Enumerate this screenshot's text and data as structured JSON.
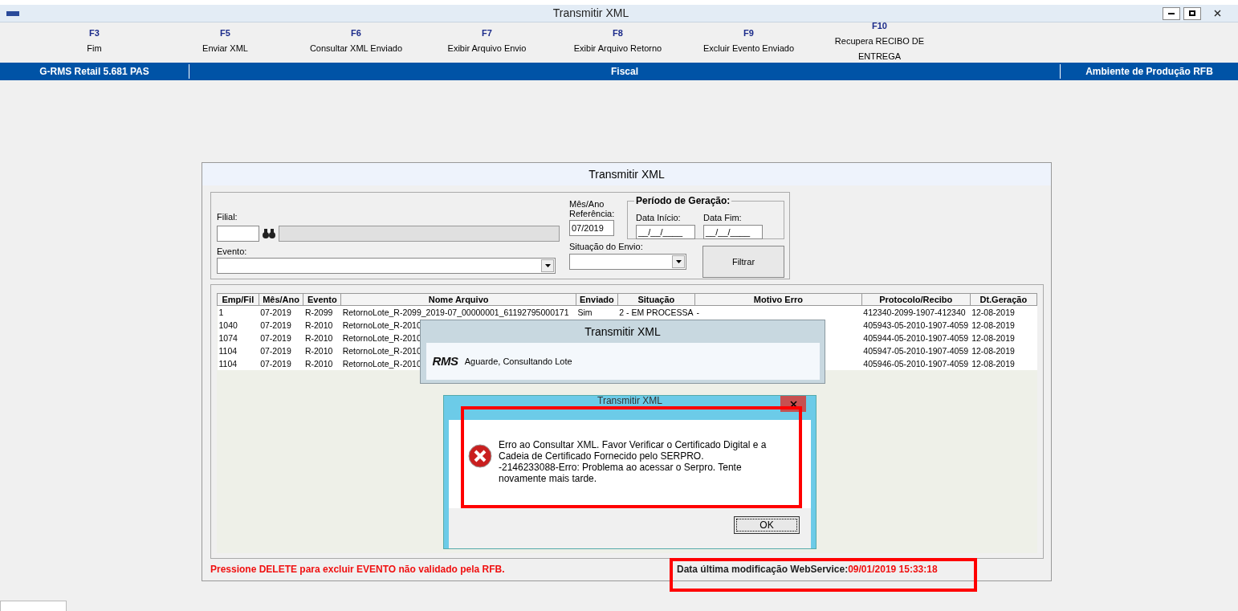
{
  "window": {
    "title": "Transmitir XML"
  },
  "toolbar": [
    {
      "key": "F3",
      "label": "Fim"
    },
    {
      "key": "F5",
      "label": "Enviar XML"
    },
    {
      "key": "F6",
      "label": "Consultar XML Enviado"
    },
    {
      "key": "F7",
      "label": "Exibir Arquivo Envio"
    },
    {
      "key": "F8",
      "label": "Exibir Arquivo Retorno"
    },
    {
      "key": "F9",
      "label": "Excluir Evento Enviado"
    },
    {
      "key": "F10",
      "label": "Recupera RECIBO DE ENTREGA"
    }
  ],
  "info_bar": {
    "version": "G-RMS Retail 5.681 PAS",
    "module": "Fiscal",
    "environment": "Ambiente de Produção RFB"
  },
  "panel": {
    "title": "Transmitir XML",
    "filters": {
      "filial_label": "Filial:",
      "evento_label": "Evento:",
      "mes_ano_label": "Mês/Ano Referência:",
      "mes_ano_value": "07/2019",
      "situacao_label": "Situação do Envio:",
      "periodo_title": "Período de Geração:",
      "data_inicio_label": "Data Início:",
      "data_inicio_value": "__/__/____",
      "data_fim_label": "Data Fim:",
      "data_fim_value": "__/__/____",
      "filter_button": "Filtrar"
    },
    "table": {
      "columns": [
        "Emp/Fil",
        "Mês/Ano",
        "Evento",
        "Nome Arquivo",
        "Enviado",
        "Situação",
        "Motivo Erro",
        "Protocolo/Recibo",
        "Dt.Geração"
      ],
      "rows": [
        [
          "1",
          "07-2019",
          "R-2099",
          "RetornoLote_R-2099_2019-07_00000001_61192795000171",
          "Sim",
          "2 - EM PROCESSA",
          "-",
          "412340-2099-1907-412340",
          "12-08-2019"
        ],
        [
          "1040",
          "07-2019",
          "R-2010",
          "RetornoLote_R-2010",
          "",
          "",
          "",
          "405943-05-2010-1907-4059",
          "12-08-2019"
        ],
        [
          "1074",
          "07-2019",
          "R-2010",
          "RetornoLote_R-2010",
          "",
          "",
          "",
          "405944-05-2010-1907-4059",
          "12-08-2019"
        ],
        [
          "1104",
          "07-2019",
          "R-2010",
          "RetornoLote_R-2010",
          "",
          "",
          "",
          "405947-05-2010-1907-4059",
          "12-08-2019"
        ],
        [
          "1104",
          "07-2019",
          "R-2010",
          "RetornoLote_R-2010",
          "",
          "",
          "",
          "405946-05-2010-1907-4059",
          "12-08-2019"
        ]
      ]
    },
    "hint": "Pressione DELETE para excluir EVENTO não validado pela RFB.",
    "webservice_label": "Data última modificação WebService:",
    "webservice_value": "09/01/2019 15:33:18"
  },
  "progress_dialog": {
    "title": "Transmitir XML",
    "logo": "RMS",
    "message": "Aguarde, Consultando Lote"
  },
  "error_dialog": {
    "title": "Transmitir XML",
    "message": "Erro ao Consultar XML. Favor Verificar o Certificado Digital e a Cadeia de Certificado Fornecido pelo SERPRO.",
    "detail": "-2146233088-Erro: Problema ao acessar o Serpro. Tente novamente mais tarde.",
    "ok_button": "OK"
  }
}
